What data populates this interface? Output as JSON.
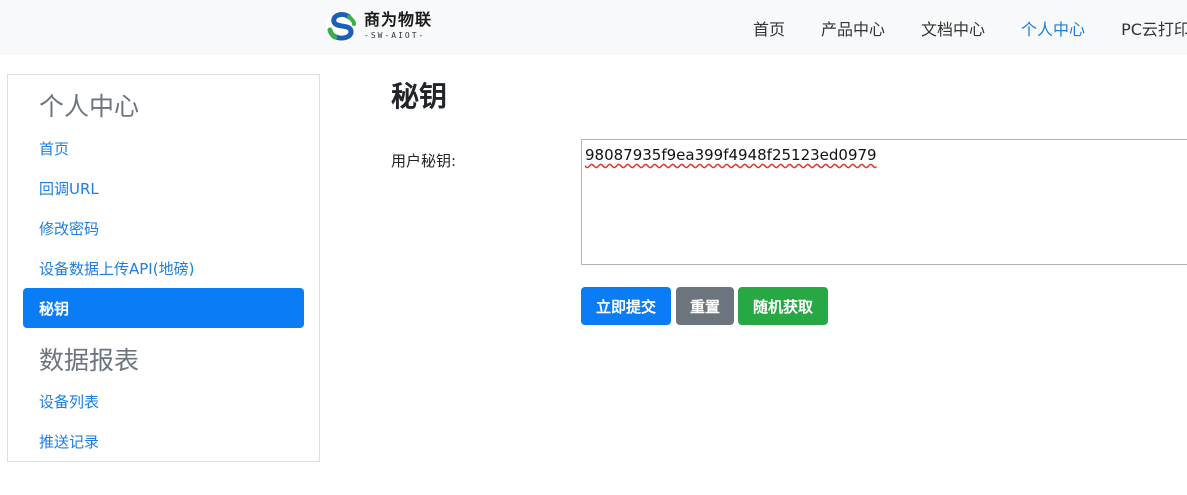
{
  "brand": {
    "name_cn": "商为物联",
    "name_en": "-SW-AIOT-",
    "colors": {
      "primary": "#0a7cf5",
      "secondary": "#6c757d",
      "success": "#28a745",
      "nav_active": "#1a7fe0"
    }
  },
  "navbar": {
    "items": [
      {
        "label": "首页",
        "active": false
      },
      {
        "label": "产品中心",
        "active": false
      },
      {
        "label": "文档中心",
        "active": false
      },
      {
        "label": "个人中心",
        "active": true
      },
      {
        "label": "PC云打印",
        "active": false
      }
    ]
  },
  "sidebar": {
    "groups": [
      {
        "title": "个人中心",
        "items": [
          {
            "label": "首页"
          },
          {
            "label": "回调URL"
          },
          {
            "label": "修改密码"
          },
          {
            "label": "设备数据上传API(地磅)"
          },
          {
            "label": "秘钥",
            "active": true
          }
        ]
      },
      {
        "title": "数据报表",
        "items": [
          {
            "label": "设备列表"
          },
          {
            "label": "推送记录"
          }
        ]
      }
    ]
  },
  "main": {
    "title": "秘钥",
    "field_label": "用户秘钥:",
    "key_value": "98087935f9ea399f4948f25123ed0979",
    "buttons": {
      "submit": "立即提交",
      "reset": "重置",
      "random": "随机获取"
    }
  }
}
